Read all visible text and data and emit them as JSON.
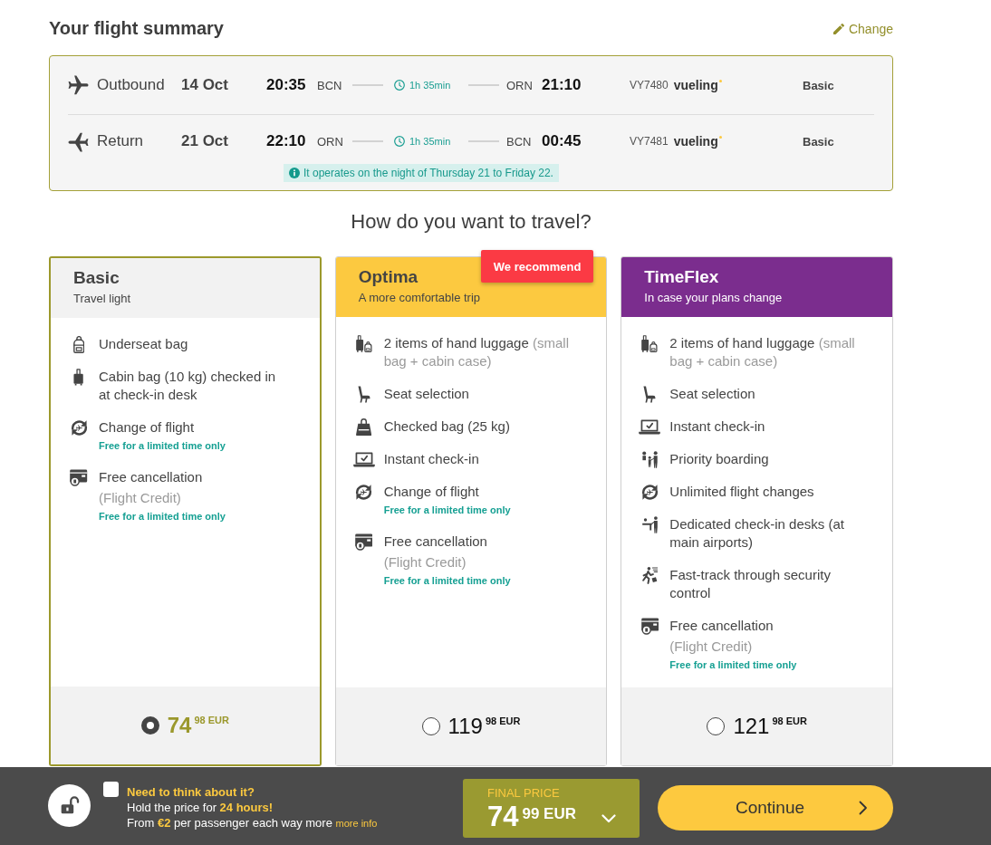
{
  "summary": {
    "title": "Your flight summary",
    "change_link": "Change",
    "flights": [
      {
        "kind": "outbound",
        "label": "Outbound",
        "date": "14 Oct",
        "departure_time": "20:35",
        "departure_airport": "BCN",
        "duration": "1h 35min",
        "arrival_airport": "ORN",
        "arrival_time": "21:10",
        "flight_number": "VY7480",
        "airline": "vueling",
        "fare": "Basic"
      },
      {
        "kind": "return",
        "label": "Return",
        "date": "21 Oct",
        "departure_time": "22:10",
        "departure_airport": "ORN",
        "duration": "1h 35min",
        "arrival_airport": "BCN",
        "arrival_time": "00:45",
        "flight_number": "VY7481",
        "airline": "vueling",
        "fare": "Basic"
      }
    ],
    "notice": "It operates on the night of Thursday 21 to Friday 22."
  },
  "fares": {
    "title": "How do you want to travel?",
    "options": [
      {
        "name": "Basic",
        "subtitle": "Travel light",
        "color": "#f2f2f2",
        "selected": true,
        "features": [
          {
            "kind": "underseat_bag",
            "text": "Underseat bag"
          },
          {
            "kind": "cabin_bag",
            "text": "Cabin bag (10 kg) checked in at check-in desk"
          },
          {
            "kind": "flight_change",
            "text": "Change of flight",
            "promo": "Free for a limited time only"
          },
          {
            "kind": "cancellation",
            "text": "Free cancellation",
            "detail": "(Flight Credit)",
            "promo": "Free for a limited time only"
          }
        ],
        "price": {
          "whole": "74",
          "cents": "98",
          "currency": "EUR"
        }
      },
      {
        "name": "Optima",
        "subtitle": "A more comfortable trip",
        "color": "#fcc940",
        "selected": false,
        "badge": "We recommend",
        "features": [
          {
            "kind": "hand_luggage",
            "text": "2 items of hand luggage",
            "note": "(small bag + cabin case)"
          },
          {
            "kind": "seat",
            "text": "Seat selection"
          },
          {
            "kind": "checked_bag",
            "text": "Checked bag (25 kg)"
          },
          {
            "kind": "checkin",
            "text": "Instant check-in"
          },
          {
            "kind": "flight_change",
            "text": "Change of flight",
            "promo": "Free for a limited time only"
          },
          {
            "kind": "cancellation",
            "text": "Free cancellation",
            "detail": "(Flight Credit)",
            "promo": "Free for a limited time only"
          }
        ],
        "price": {
          "whole": "119",
          "cents": "98",
          "currency": "EUR"
        }
      },
      {
        "name": "TimeFlex",
        "subtitle": "In case your plans change",
        "color": "#7b2d8e",
        "selected": false,
        "features": [
          {
            "kind": "hand_luggage",
            "text": "2 items of hand luggage",
            "note": "(small bag + cabin case)"
          },
          {
            "kind": "seat",
            "text": "Seat selection"
          },
          {
            "kind": "checkin",
            "text": "Instant check-in"
          },
          {
            "kind": "priority",
            "text": "Priority boarding"
          },
          {
            "kind": "flight_change",
            "text": "Unlimited flight changes"
          },
          {
            "kind": "desk",
            "text": "Dedicated check-in desks (at main airports)"
          },
          {
            "kind": "fast_track",
            "text": "Fast-track through security control"
          },
          {
            "kind": "cancellation",
            "text": "Free cancellation",
            "detail": "(Flight Credit)",
            "promo": "Free for a limited time only"
          }
        ],
        "price": {
          "whole": "121",
          "cents": "98",
          "currency": "EUR"
        }
      }
    ]
  },
  "hold": {
    "checked": false,
    "title": "Need to think about it?",
    "text": "Hold the price for **24 hours!**",
    "fee": "From **€2** per passenger each way more",
    "link": "more info"
  },
  "final_price": {
    "label": "FINAL PRICE",
    "whole": "74",
    "cents": "99",
    "currency": "EUR"
  },
  "continue_button": "Continue"
}
